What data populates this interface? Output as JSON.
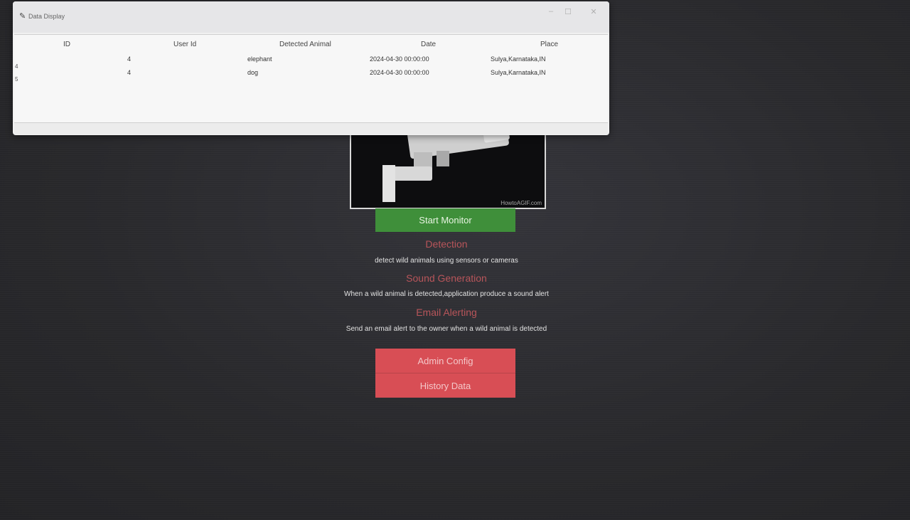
{
  "window": {
    "title": "Data Display",
    "table": {
      "columns": [
        "ID",
        "User Id",
        "Detected Animal",
        "Date",
        "Place"
      ],
      "rows": [
        {
          "index": "4",
          "id": "",
          "user_id": "4",
          "animal": "elephant",
          "date": "2024-04-30 00:00:00",
          "place": "Sulya,Karnataka,IN"
        },
        {
          "index": "5",
          "id": "",
          "user_id": "4",
          "animal": "dog",
          "date": "2024-04-30 00:00:00",
          "place": "Sulya,Karnataka,IN"
        }
      ]
    }
  },
  "app": {
    "camera_watermark": "HowtoAGIF.com",
    "start_button": "Start Monitor",
    "sections": [
      {
        "title": "Detection",
        "desc": "detect wild animals using sensors or cameras"
      },
      {
        "title": "Sound Generation",
        "desc": "When a wild animal is detected,application produce a sound alert"
      },
      {
        "title": "Email Alerting",
        "desc": "Send an email alert to the owner when a wild animal is detected"
      }
    ],
    "admin_button": "Admin Config",
    "history_button": "History Data"
  },
  "colors": {
    "background": "#2b2b2e",
    "start_button": "#3f8f3a",
    "action_buttons": "#d84e55",
    "section_title": "#b8555a"
  },
  "icons": [
    "feather-icon",
    "minimize-icon",
    "maximize-icon",
    "close-icon",
    "security-camera-icon"
  ]
}
